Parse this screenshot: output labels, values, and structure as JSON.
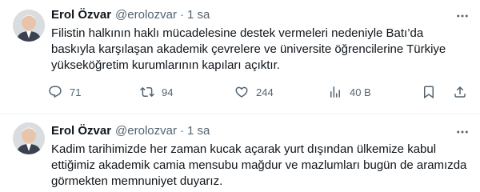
{
  "tweets": [
    {
      "author_name": "Erol Özvar",
      "handle": "@erolozvar",
      "separator": "·",
      "time": "1 sa",
      "text": "Filistin halkının haklı mücadelesine destek vermeleri nedeniyle Batı’da baskıyla karşılaşan akademik çevrelere ve üniversite öğrencilerine Türkiye yükseköğretim kurumlarının kapıları açıktır.",
      "stats": {
        "replies": "71",
        "reposts": "94",
        "likes": "244",
        "views": "40 B"
      }
    },
    {
      "author_name": "Erol Özvar",
      "handle": "@erolozvar",
      "separator": "·",
      "time": "1 sa",
      "text": "Kadim tarihimizde her zaman kucak açarak yurt dışından ülkemize kabul ettiğimiz akademik camia mensubu mağdur ve mazlumları bugün de aramızda görmekten memnuniyet duyarız."
    }
  ],
  "icons": {
    "more": "more-icon",
    "reply": "reply-icon",
    "repost": "repost-icon",
    "like": "like-icon",
    "views": "views-icon",
    "bookmark": "bookmark-icon",
    "share": "share-icon"
  },
  "colors": {
    "text": "#0f1419",
    "secondary": "#536471",
    "divider": "#eff3f4"
  }
}
